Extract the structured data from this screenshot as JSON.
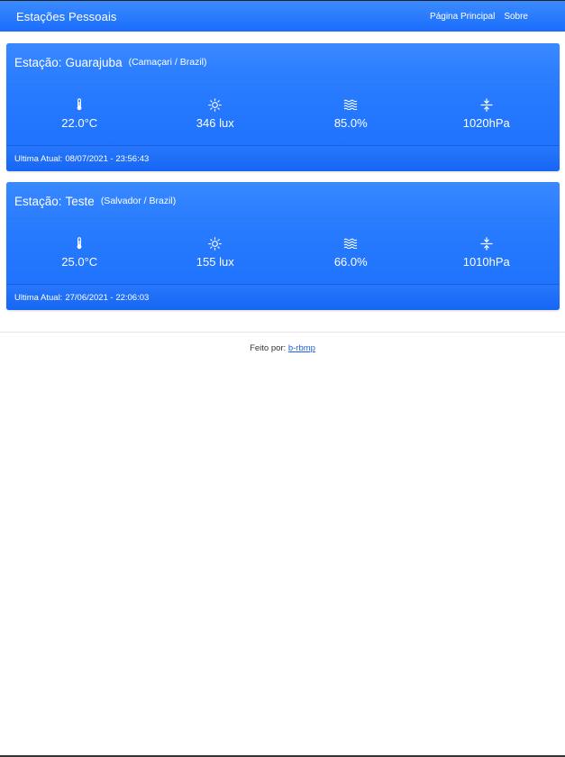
{
  "navbar": {
    "brand": "Estações Pessoais",
    "links": [
      "Página Principal",
      "Sobre"
    ]
  },
  "stations": [
    {
      "label": "Estação:",
      "name": "Guarajuba",
      "location": "(Camaçari / Brazil)",
      "temperature": "22.0°C",
      "light": "346 lux",
      "humidity": "85.0%",
      "pressure": "1020hPa",
      "updated_label": "Ultima Atual:",
      "updated_value": "08/07/2021 - 23:56:43"
    },
    {
      "label": "Estação:",
      "name": "Teste",
      "location": "(Salvador / Brazil)",
      "temperature": "25.0°C",
      "light": "155 lux",
      "humidity": "66.0%",
      "pressure": "1010hPa",
      "updated_label": "Ultima Atual:",
      "updated_value": "27/06/2021 - 22:06:03"
    }
  ],
  "footer": {
    "prefix": "Feito por:",
    "author": "b-rbmp"
  },
  "icons": {
    "temperature": "thermometer-icon",
    "light": "sun-icon",
    "humidity": "humidity-waves-icon",
    "pressure": "pressure-compress-icon"
  },
  "colors": {
    "primary": "#1b6ffc",
    "link": "#1b62e0"
  }
}
